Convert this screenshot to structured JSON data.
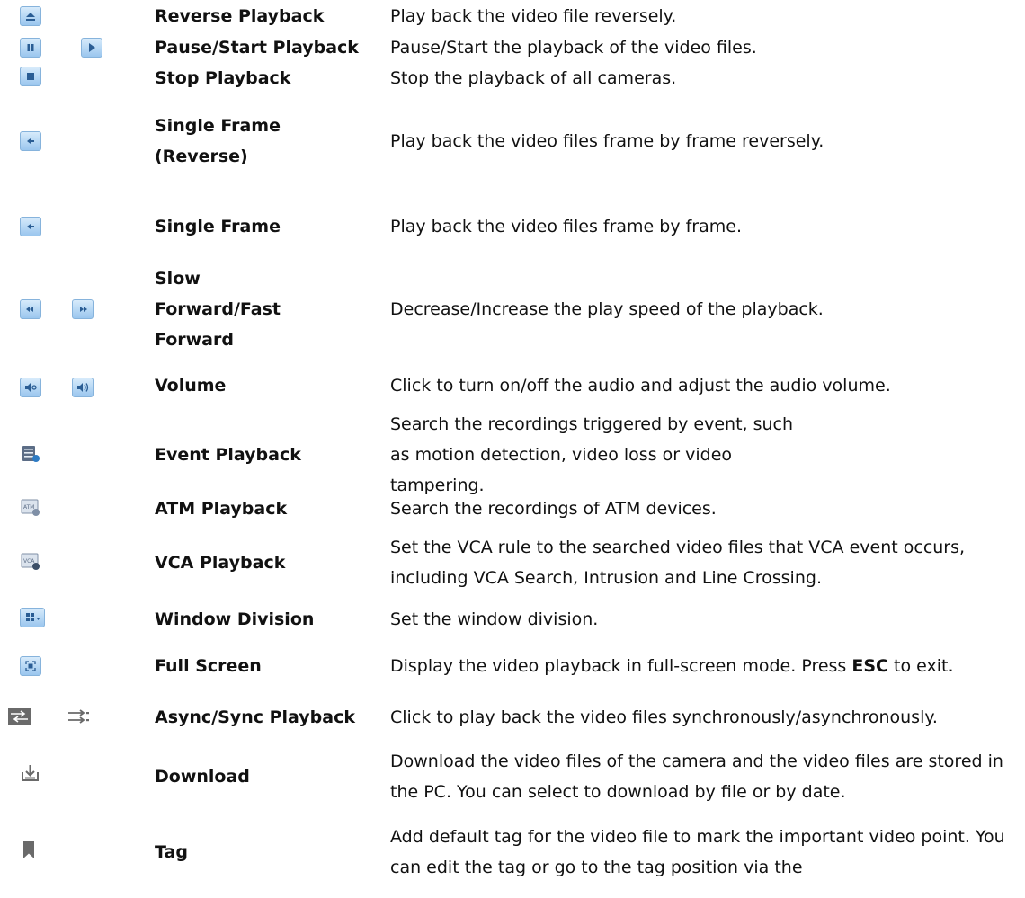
{
  "rows": [
    {
      "name": "Reverse Playback",
      "desc": "Play back the video file reversely.",
      "icons": [
        "reverse-playback-icon"
      ]
    },
    {
      "name": "Pause/Start Playback",
      "desc": "Pause/Start the playback of the video files.",
      "icons": [
        "pause-icon",
        "play-icon"
      ]
    },
    {
      "name": "Stop Playback",
      "desc": "Stop the playback of all cameras.",
      "icons": [
        "stop-icon"
      ]
    },
    {
      "name": "Single Frame (Reverse)",
      "desc": "Play back the video files frame by frame reversely.",
      "icons": [
        "single-frame-reverse-icon"
      ]
    },
    {
      "name": "Single Frame",
      "desc": "Play back the video files frame by frame.",
      "icons": [
        "single-frame-icon"
      ]
    },
    {
      "name": "Slow Forward/Fast Forward",
      "desc": "Decrease/Increase the play speed of the playback.",
      "icons": [
        "slow-forward-icon",
        "fast-forward-icon"
      ]
    },
    {
      "name": "Volume",
      "desc": "Click to turn on/off the audio and adjust the audio volume.",
      "icons": [
        "volume-off-icon",
        "volume-on-icon"
      ]
    },
    {
      "name": "Event Playback",
      "desc": "Search the recordings triggered by event, such as motion detection, video loss or video tampering.",
      "icons": [
        "event-playback-icon"
      ]
    },
    {
      "name": "ATM Playback",
      "desc": "Search the recordings of ATM devices.",
      "icons": [
        "atm-playback-icon"
      ]
    },
    {
      "name": "VCA Playback",
      "desc": "Set the VCA rule to the searched video files that VCA event occurs, including VCA Search, Intrusion and Line Crossing.",
      "icons": [
        "vca-playback-icon"
      ]
    },
    {
      "name": "Window Division",
      "desc": "Set the window division.",
      "icons": [
        "window-division-icon"
      ]
    },
    {
      "name": "Full Screen",
      "desc_pre": "Display the video playback in full-screen mode. Press ",
      "desc_key": "ESC",
      "desc_post": " to exit.",
      "icons": [
        "full-screen-icon"
      ]
    },
    {
      "name": "Async/Sync Playback",
      "desc": "Click to play back the video files synchronously/asynchronously.",
      "icons": [
        "async-icon",
        "sync-icon"
      ]
    },
    {
      "name": "Download",
      "desc": "Download the video files of the camera and the video files are stored in the PC. You can select to download by file or by date.",
      "icons": [
        "download-icon"
      ]
    },
    {
      "name": "Tag",
      "desc": "Add default tag for the video file to mark the important video point. You can edit the tag or go to the tag position via the",
      "icons": [
        "tag-icon"
      ]
    }
  ],
  "colors": {
    "button_top": "#d7ebfb",
    "button_bottom": "#9ac6ee",
    "glyph": "#2a5d94",
    "flat_icon": "#6a6a6a"
  }
}
